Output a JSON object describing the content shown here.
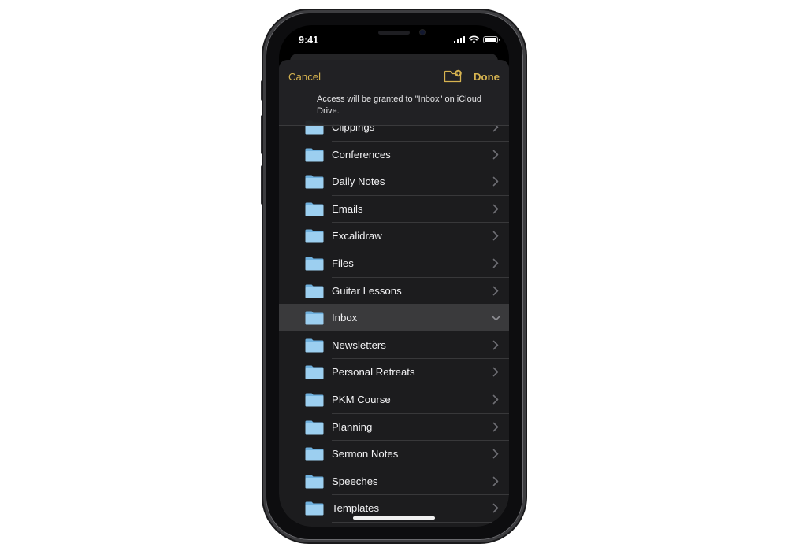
{
  "status_bar": {
    "time": "9:41",
    "icons": [
      "cellular-signal-icon",
      "wifi-icon",
      "battery-icon"
    ]
  },
  "header": {
    "cancel_label": "Cancel",
    "done_label": "Done",
    "new_folder_icon": "new-folder-icon",
    "prompt": "Access will be granted to \"Inbox\" on iCloud Drive."
  },
  "folders": [
    {
      "label": "Clippings",
      "state": "partially-hidden"
    },
    {
      "label": "Conferences"
    },
    {
      "label": "Daily Notes"
    },
    {
      "label": "Emails"
    },
    {
      "label": "Excalidraw"
    },
    {
      "label": "Files"
    },
    {
      "label": "Guitar Lessons"
    },
    {
      "label": "Inbox",
      "selected": true,
      "expanded": true
    },
    {
      "label": "Newsletters"
    },
    {
      "label": "Personal Retreats"
    },
    {
      "label": "PKM Course"
    },
    {
      "label": "Planning"
    },
    {
      "label": "Sermon Notes"
    },
    {
      "label": "Speeches"
    },
    {
      "label": "Templates"
    }
  ],
  "colors": {
    "accent": "#d6b350",
    "background": "#1c1c1e",
    "selected_row": "#3a3a3c",
    "folder_icon": "#8cc4ea"
  }
}
